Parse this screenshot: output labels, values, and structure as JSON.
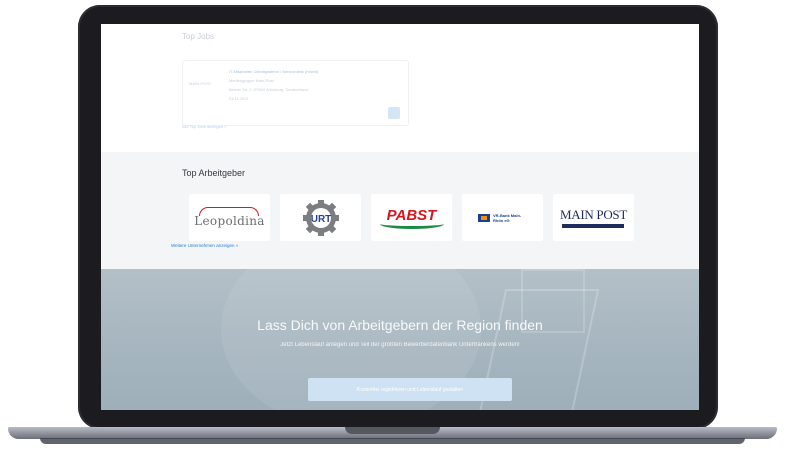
{
  "jobs": {
    "title": "Top Jobs",
    "card": {
      "logo_text": "MAIN-POST",
      "title": "IT-Mitarbeiter Clientsysteme / Servicedesk (m/w/d)",
      "company": "Mediengruppe Main-Post",
      "address": "Berner Str. 2, 97084 Würzburg, Deutschland",
      "date": "03.11.2021"
    },
    "show_all": "Alle Top Jobs anzeigen »"
  },
  "employers": {
    "title": "Top Arbeitgeber",
    "logos": [
      {
        "name": "Leopoldina",
        "text": "Leopoldina"
      },
      {
        "name": "URT",
        "text": "URT"
      },
      {
        "name": "PABST",
        "text": "PABST"
      },
      {
        "name": "VR-Bank Main-Rhön eG",
        "text": "VR-Bank Main-Rhön eG"
      },
      {
        "name": "MAIN POST",
        "text": "MAIN POST"
      }
    ],
    "more": "Weitere Unternehmen anzeigen »"
  },
  "hero": {
    "title": "Lass Dich von Arbeitgebern der Region finden",
    "subtitle": "Jetzt Lebenslauf anlegen und Teil der größten Bewerberdatenbank Unterfrankens werden!",
    "button": "Kostenfrei registrieren und Lebenslauf gestalten"
  },
  "colors": {
    "accent": "#2d7fd1",
    "hero_bg": "#a8b7c0",
    "laptop_frame": "#1b1b20"
  }
}
